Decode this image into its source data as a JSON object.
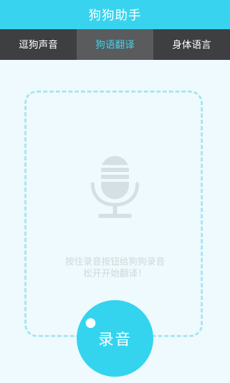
{
  "app": {
    "title": "狗狗助手"
  },
  "tabs": [
    {
      "label": "逗狗声音",
      "active": false
    },
    {
      "label": "狗语翻译",
      "active": true
    },
    {
      "label": "身体语言",
      "active": false
    }
  ],
  "record_panel": {
    "icon": "microphone-icon",
    "hint_line1": "按住录音按钮给狗狗录音",
    "hint_line2": "松开开始翻译！"
  },
  "record_button": {
    "label": "录音"
  },
  "colors": {
    "accent": "#38d3ee",
    "tab_bar": "#3d3f41",
    "tab_active": "#595b5d",
    "background": "#eefafd",
    "frame_border": "#a9e5f1",
    "icon_grey": "#d4e0e3",
    "hint_text": "#cfd8da"
  }
}
